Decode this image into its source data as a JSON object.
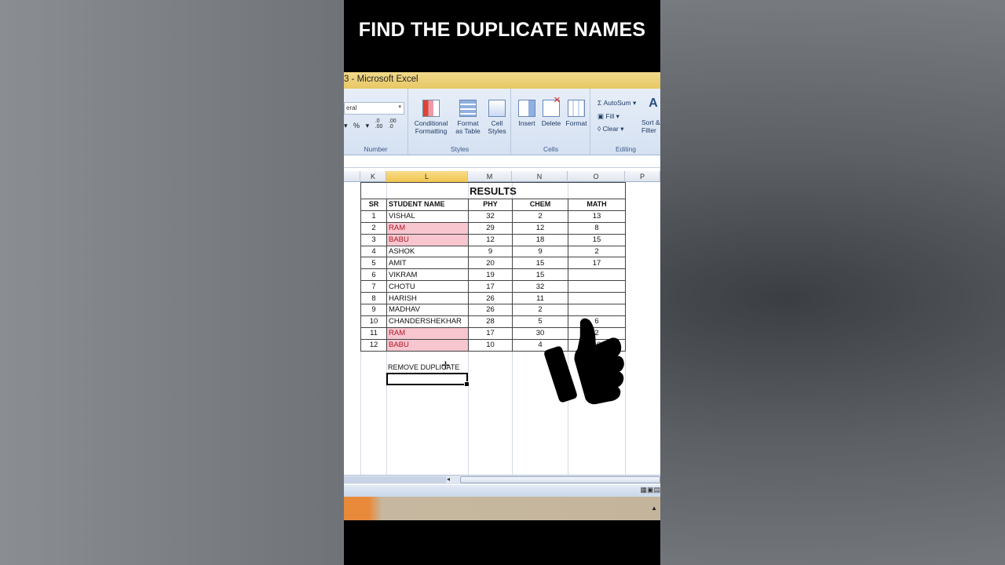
{
  "headline": "FIND THE DUPLICATE NAMES",
  "window_title": "3 - Microsoft Excel",
  "ribbon": {
    "number_format": "eral",
    "number_symbols": [
      "%",
      ",",
      ".00→.0",
      ".0→.00"
    ],
    "number_group": "Number",
    "styles_group": "Styles",
    "cells_group": "Cells",
    "editing_group": "Editing",
    "conditional_formatting": "Conditional\nFormatting",
    "format_as_table": "Format\nas Table",
    "cell_styles": "Cell\nStyles",
    "insert": "Insert",
    "delete": "Delete",
    "format": "Format",
    "autosum": "Σ AutoSum ▾",
    "fill": "Fill ▾",
    "clear": "Clear ▾",
    "sort_filter": "Sort &\nFilter"
  },
  "columns": [
    "K",
    "L",
    "M",
    "N",
    "O",
    "P"
  ],
  "table": {
    "title": "RESULTS",
    "headers": [
      "SR",
      "STUDENT NAME",
      "PHY",
      "CHEM",
      "MATH"
    ],
    "rows": [
      {
        "sr": "1",
        "name": "VISHAL",
        "phy": "32",
        "chem": "2",
        "math": "13",
        "dup": false
      },
      {
        "sr": "2",
        "name": "RAM",
        "phy": "29",
        "chem": "12",
        "math": "8",
        "dup": true
      },
      {
        "sr": "3",
        "name": "BABU",
        "phy": "12",
        "chem": "18",
        "math": "15",
        "dup": true
      },
      {
        "sr": "4",
        "name": "ASHOK",
        "phy": "9",
        "chem": "9",
        "math": "2",
        "dup": false
      },
      {
        "sr": "5",
        "name": "AMIT",
        "phy": "20",
        "chem": "15",
        "math": "17",
        "dup": false
      },
      {
        "sr": "6",
        "name": "VIKRAM",
        "phy": "19",
        "chem": "15",
        "math": "",
        "dup": false
      },
      {
        "sr": "7",
        "name": "CHOTU",
        "phy": "17",
        "chem": "32",
        "math": "",
        "dup": false
      },
      {
        "sr": "8",
        "name": "HARISH",
        "phy": "26",
        "chem": "11",
        "math": "",
        "dup": false
      },
      {
        "sr": "9",
        "name": "MADHAV",
        "phy": "26",
        "chem": "2",
        "math": "",
        "dup": false
      },
      {
        "sr": "10",
        "name": "CHANDERSHEKHAR",
        "phy": "28",
        "chem": "5",
        "math": "6",
        "dup": false
      },
      {
        "sr": "11",
        "name": "RAM",
        "phy": "17",
        "chem": "30",
        "math": "2",
        "dup": true
      },
      {
        "sr": "12",
        "name": "BABU",
        "phy": "10",
        "chem": "4",
        "math": "10",
        "dup": true
      }
    ]
  },
  "remove_label": "REMOVE DUPLICATE",
  "colors": {
    "duplicate_fill": "#f8c6cf",
    "duplicate_text": "#b0182a",
    "title_bar": "#e8c866"
  }
}
